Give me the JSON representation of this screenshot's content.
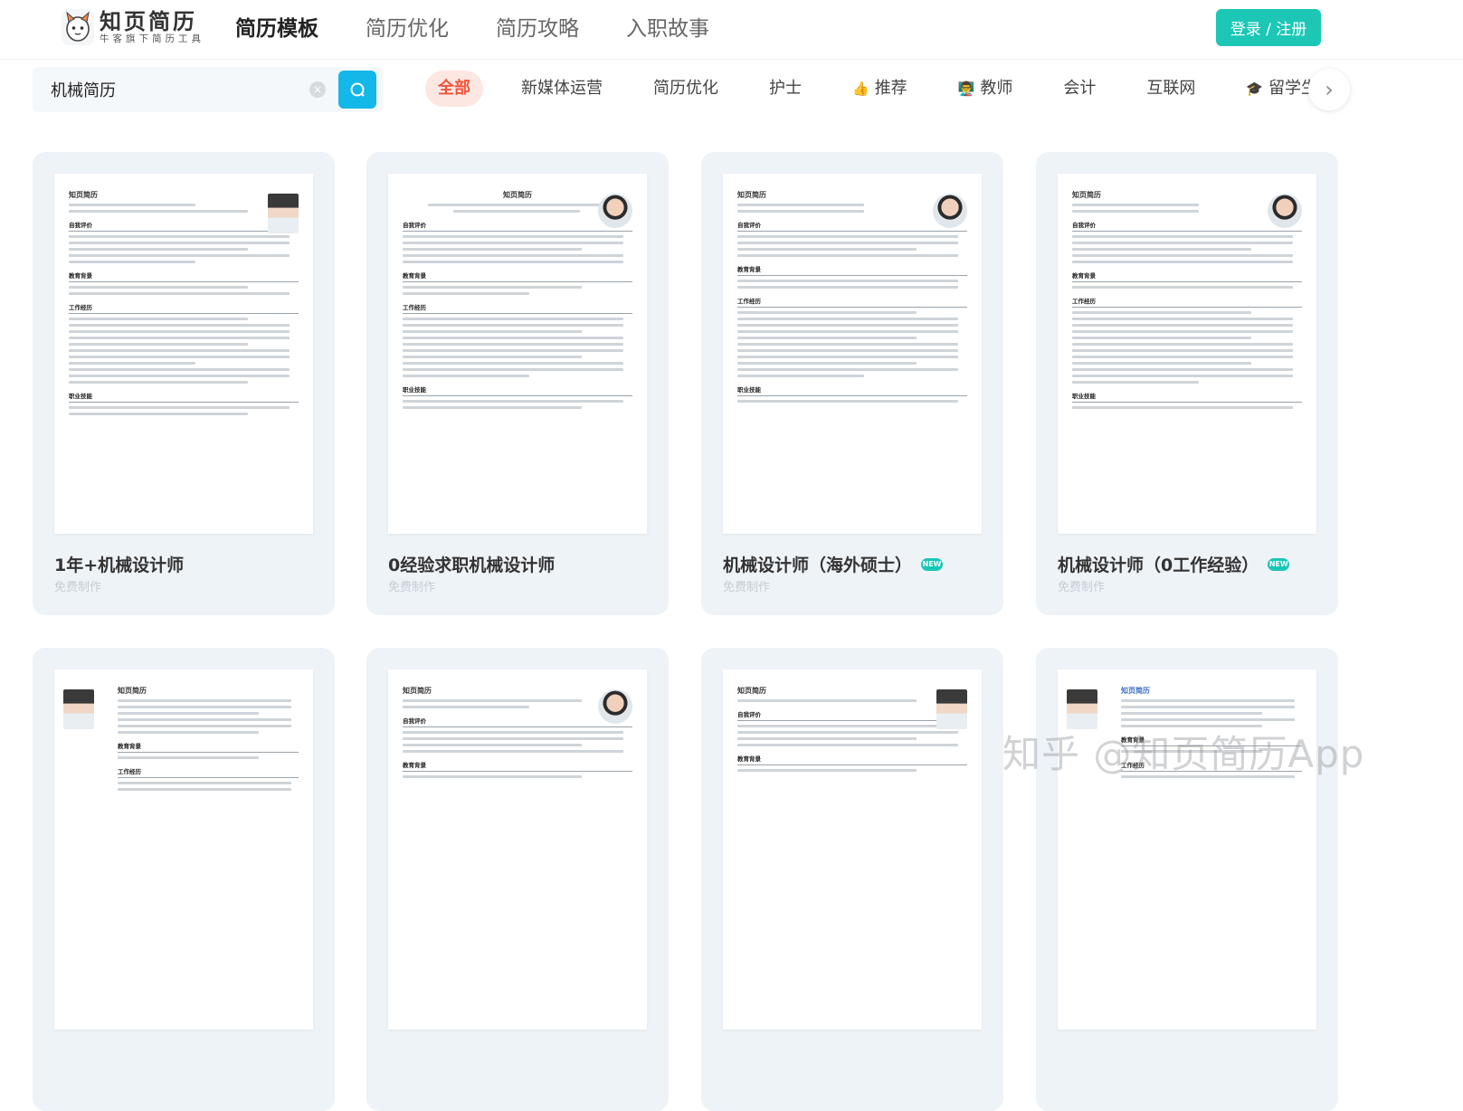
{
  "header": {
    "logo_name": "知页简历",
    "logo_sub": "牛客旗下简历工具",
    "nav": [
      {
        "label": "简历模板",
        "active": true
      },
      {
        "label": "简历优化",
        "active": false
      },
      {
        "label": "简历攻略",
        "active": false
      },
      {
        "label": "入职故事",
        "active": false
      }
    ],
    "login_label": "登录 / 注册"
  },
  "search": {
    "value": "机械简历",
    "clear_icon": "×"
  },
  "filters": [
    {
      "label": "全部",
      "active": true,
      "icon": ""
    },
    {
      "label": "新媒体运营",
      "active": false,
      "icon": ""
    },
    {
      "label": "简历优化",
      "active": false,
      "icon": ""
    },
    {
      "label": "护士",
      "active": false,
      "icon": ""
    },
    {
      "label": "推荐",
      "active": false,
      "icon": "👍"
    },
    {
      "label": "教师",
      "active": false,
      "icon": "👨‍🏫"
    },
    {
      "label": "会计",
      "active": false,
      "icon": ""
    },
    {
      "label": "互联网",
      "active": false,
      "icon": ""
    },
    {
      "label": "留学生",
      "active": false,
      "icon": "🎓"
    }
  ],
  "cards": [
    {
      "title": "1年+机械设计师",
      "sub": "免费制作",
      "new": false,
      "resume_name": "知页简历",
      "avatar": "female"
    },
    {
      "title": "0经验求职机械设计师",
      "sub": "免费制作",
      "new": false,
      "resume_name": "知页简历",
      "avatar": "male"
    },
    {
      "title": "机械设计师（海外硕士）",
      "sub": "免费制作",
      "new": true,
      "resume_name": "知页简历",
      "avatar": "male"
    },
    {
      "title": "机械设计师（0工作经验）",
      "sub": "免费制作",
      "new": true,
      "resume_name": "知页简历",
      "avatar": "male"
    },
    {
      "title": "",
      "sub": "",
      "new": false,
      "resume_name": "知页简历",
      "avatar": "female"
    },
    {
      "title": "",
      "sub": "",
      "new": false,
      "resume_name": "知页简历",
      "avatar": "male"
    },
    {
      "title": "",
      "sub": "",
      "new": false,
      "resume_name": "知页简历",
      "avatar": "female"
    },
    {
      "title": "",
      "sub": "",
      "new": false,
      "resume_name": "知页简历",
      "avatar": "female"
    }
  ],
  "badge_new": "NEW",
  "resume_sections": [
    "自我评价",
    "教育背景",
    "工作经历",
    "职业技能"
  ],
  "watermark": "知乎 @知页简历App",
  "colors": {
    "accent": "#1cc7b6",
    "search": "#13b7e8",
    "chip_active_bg": "#fde7e2",
    "chip_active_text": "#f0543b",
    "card_bg": "#eef3f8"
  }
}
